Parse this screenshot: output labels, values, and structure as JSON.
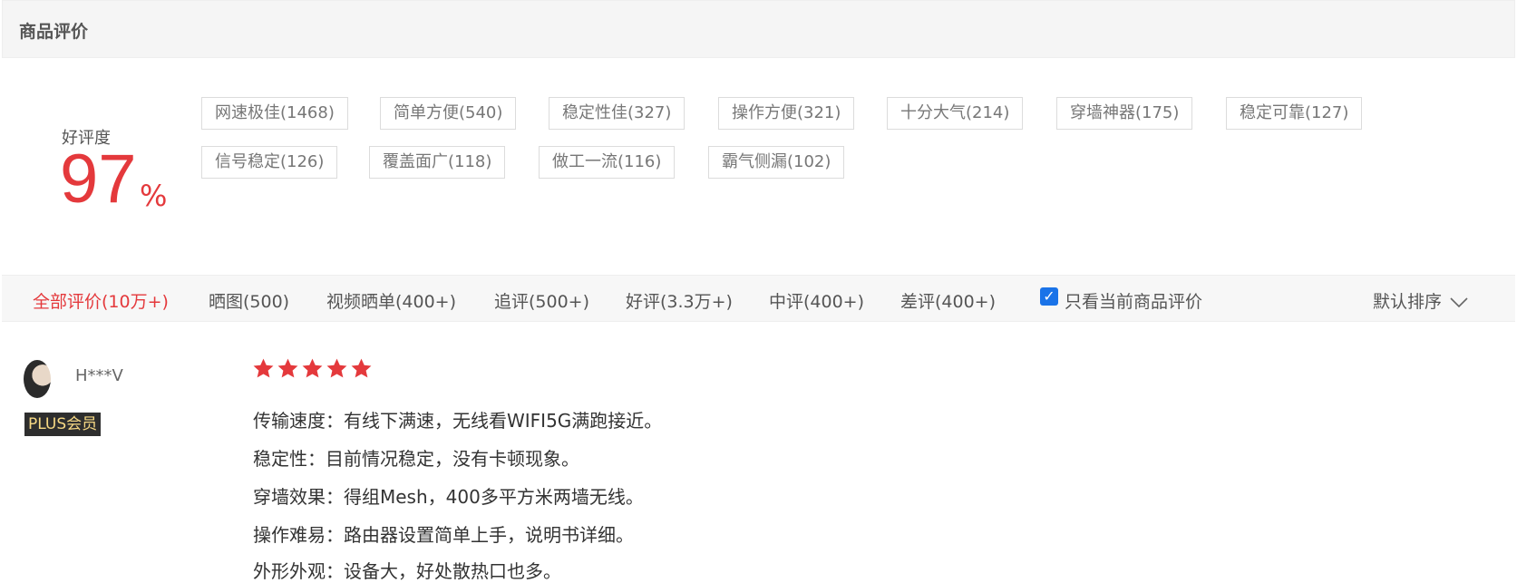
{
  "header": {
    "title": "商品评价"
  },
  "rating": {
    "label": "好评度",
    "value": "97",
    "unit": "%"
  },
  "tags": [
    "网速极佳(1468)",
    "简单方便(540)",
    "稳定性佳(327)",
    "操作方便(321)",
    "十分大气(214)",
    "穿墙神器(175)",
    "稳定可靠(127)",
    "信号稳定(126)",
    "覆盖面广(118)",
    "做工一流(116)",
    "霸气侧漏(102)"
  ],
  "filters": [
    "全部评价(10万+)",
    "晒图(500)",
    "视频晒单(400+)",
    "追评(500+)",
    "好评(3.3万+)",
    "中评(400+)",
    "差评(400+)"
  ],
  "only_current": {
    "label": "只看当前商品评价",
    "checked": true
  },
  "sort": {
    "label": "默认排序"
  },
  "colors": {
    "accent": "#e4393c",
    "checkbox": "#1a73e8"
  },
  "review": {
    "username": "H***V",
    "badge": "PLUS会员",
    "stars": 5,
    "lines": [
      "传输速度：有线下满速，无线看WIFI5G满跑接近。",
      "稳定性：目前情况稳定，没有卡顿现象。",
      "穿墙效果：得组Mesh，400多平方米两墙无线。",
      "操作难易：路由器设置简单上手，说明书详细。",
      "外形外观：设备大，好处散热口也多。"
    ]
  }
}
